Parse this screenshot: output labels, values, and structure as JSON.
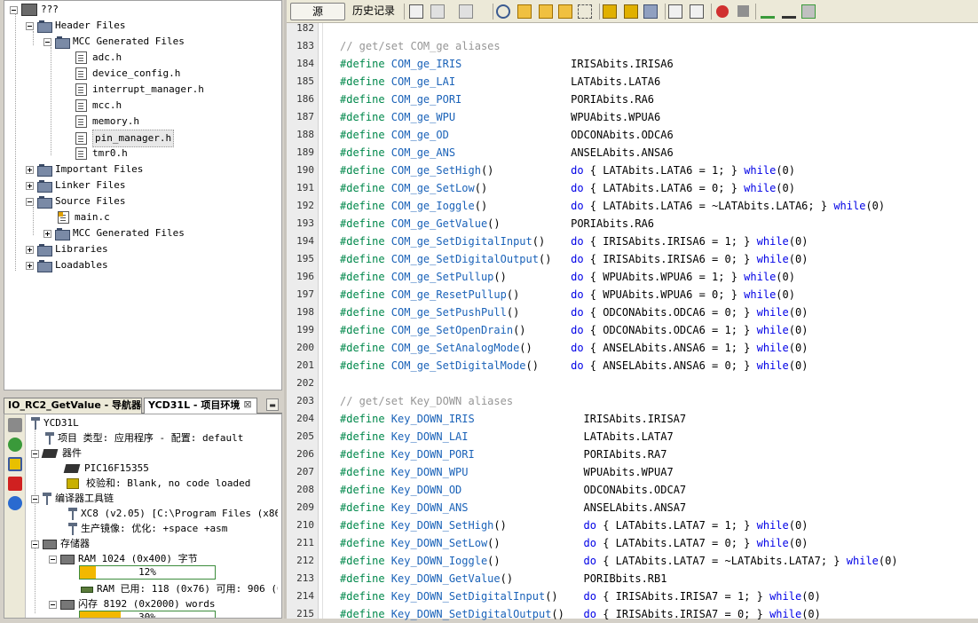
{
  "project_tree": {
    "root": "???",
    "items": [
      {
        "label": "Header Files",
        "type": "folder",
        "level": 1,
        "expanded": true
      },
      {
        "label": "MCC Generated Files",
        "type": "folder",
        "level": 2,
        "expanded": true
      },
      {
        "label": "adc.h",
        "type": "file",
        "level": 3
      },
      {
        "label": "device_config.h",
        "type": "file",
        "level": 3
      },
      {
        "label": "interrupt_manager.h",
        "type": "file",
        "level": 3
      },
      {
        "label": "mcc.h",
        "type": "file",
        "level": 3
      },
      {
        "label": "memory.h",
        "type": "file",
        "level": 3
      },
      {
        "label": "pin_manager.h",
        "type": "file",
        "level": 3,
        "selected": true
      },
      {
        "label": "tmr0.h",
        "type": "file",
        "level": 3
      },
      {
        "label": "Important Files",
        "type": "folder",
        "level": 1,
        "expanded": false
      },
      {
        "label": "Linker Files",
        "type": "folder",
        "level": 1,
        "expanded": false
      },
      {
        "label": "Source Files",
        "type": "folder",
        "level": 1,
        "expanded": true
      },
      {
        "label": "main.c",
        "type": "cfile",
        "level": 2
      },
      {
        "label": "MCC Generated Files",
        "type": "folder",
        "level": 2,
        "expanded": false
      },
      {
        "label": "Libraries",
        "type": "folder",
        "level": 1,
        "expanded": false
      },
      {
        "label": "Loadables",
        "type": "folder",
        "level": 1,
        "expanded": false
      }
    ]
  },
  "bottom_tabs": {
    "navigator": "IO_RC2_GetValue - 导航器",
    "environment": "YCD31L - 项目环境",
    "close_glyph": "⊠",
    "minimize_glyph": "▬"
  },
  "environment": {
    "project_name": "YCD31L",
    "project_type": "项目 类型: 应用程序 - 配置: default",
    "device_group": "器件",
    "device": "PIC16F15355",
    "checksum": "校验和: Blank, no code loaded",
    "toolchain_group": "编译器工具链",
    "compiler": "XC8 (v2.05) [C:\\Program Files (x86)\\M",
    "build_image": "生产镜像: 优化: +space +asm",
    "memory_group": "存储器",
    "ram_label": "RAM 1024 (0x400) 字节",
    "ram_usage_percent": 12,
    "ram_usage_label": "12%",
    "ram_used": "RAM 已用: 118 (0x76) 可用: 906 (0",
    "flash_label": "闪存 8192 (0x2000) words",
    "flash_usage_percent": 30,
    "flash_usage_label": "30%"
  },
  "editor_toolbar": {
    "source_tab": "源",
    "history_tab": "历史记录"
  },
  "code": {
    "lines": [
      {
        "n": "182",
        "parts": []
      },
      {
        "n": "183",
        "parts": [
          {
            "c": "cm",
            "t": "// get/set COM_ge aliases"
          }
        ]
      },
      {
        "n": "184",
        "parts": [
          {
            "c": "pp",
            "t": "#define "
          },
          {
            "c": "mc",
            "t": "COM_ge_IRIS"
          },
          {
            "c": "tx",
            "t": "                 IRISAbits.IRISA6"
          }
        ]
      },
      {
        "n": "185",
        "parts": [
          {
            "c": "pp",
            "t": "#define "
          },
          {
            "c": "mc",
            "t": "COM_ge_LAI"
          },
          {
            "c": "tx",
            "t": "                  LATAbits.LATA6"
          }
        ]
      },
      {
        "n": "186",
        "parts": [
          {
            "c": "pp",
            "t": "#define "
          },
          {
            "c": "mc",
            "t": "COM_ge_PORI"
          },
          {
            "c": "tx",
            "t": "                 PORIAbits.RA6"
          }
        ]
      },
      {
        "n": "187",
        "parts": [
          {
            "c": "pp",
            "t": "#define "
          },
          {
            "c": "mc",
            "t": "COM_ge_WPU"
          },
          {
            "c": "tx",
            "t": "                  WPUAbits.WPUA6"
          }
        ]
      },
      {
        "n": "188",
        "parts": [
          {
            "c": "pp",
            "t": "#define "
          },
          {
            "c": "mc",
            "t": "COM_ge_OD"
          },
          {
            "c": "tx",
            "t": "                   ODCONAbits.ODCA6"
          }
        ]
      },
      {
        "n": "189",
        "parts": [
          {
            "c": "pp",
            "t": "#define "
          },
          {
            "c": "mc",
            "t": "COM_ge_ANS"
          },
          {
            "c": "tx",
            "t": "                  ANSELAbits.ANSA6"
          }
        ]
      },
      {
        "n": "190",
        "parts": [
          {
            "c": "pp",
            "t": "#define "
          },
          {
            "c": "mc",
            "t": "COM_ge_SetHigh"
          },
          {
            "c": "tx",
            "t": "()            "
          },
          {
            "c": "kw",
            "t": "do"
          },
          {
            "c": "tx",
            "t": " { LATAbits.LATA6 = 1; } "
          },
          {
            "c": "kw",
            "t": "while"
          },
          {
            "c": "tx",
            "t": "(0)"
          }
        ]
      },
      {
        "n": "191",
        "parts": [
          {
            "c": "pp",
            "t": "#define "
          },
          {
            "c": "mc",
            "t": "COM_ge_SetLow"
          },
          {
            "c": "tx",
            "t": "()             "
          },
          {
            "c": "kw",
            "t": "do"
          },
          {
            "c": "tx",
            "t": " { LATAbits.LATA6 = 0; } "
          },
          {
            "c": "kw",
            "t": "while"
          },
          {
            "c": "tx",
            "t": "(0)"
          }
        ]
      },
      {
        "n": "192",
        "parts": [
          {
            "c": "pp",
            "t": "#define "
          },
          {
            "c": "mc",
            "t": "COM_ge_Ioggle"
          },
          {
            "c": "tx",
            "t": "()             "
          },
          {
            "c": "kw",
            "t": "do"
          },
          {
            "c": "tx",
            "t": " { LATAbits.LATA6 = ~LATAbits.LATA6; } "
          },
          {
            "c": "kw",
            "t": "while"
          },
          {
            "c": "tx",
            "t": "(0)"
          }
        ]
      },
      {
        "n": "193",
        "parts": [
          {
            "c": "pp",
            "t": "#define "
          },
          {
            "c": "mc",
            "t": "COM_ge_GetValue"
          },
          {
            "c": "tx",
            "t": "()           PORIAbits.RA6"
          }
        ]
      },
      {
        "n": "194",
        "parts": [
          {
            "c": "pp",
            "t": "#define "
          },
          {
            "c": "mc",
            "t": "COM_ge_SetDigitalInput"
          },
          {
            "c": "tx",
            "t": "()    "
          },
          {
            "c": "kw",
            "t": "do"
          },
          {
            "c": "tx",
            "t": " { IRISAbits.IRISA6 = 1; } "
          },
          {
            "c": "kw",
            "t": "while"
          },
          {
            "c": "tx",
            "t": "(0)"
          }
        ]
      },
      {
        "n": "195",
        "parts": [
          {
            "c": "pp",
            "t": "#define "
          },
          {
            "c": "mc",
            "t": "COM_ge_SetDigitalOutput"
          },
          {
            "c": "tx",
            "t": "()   "
          },
          {
            "c": "kw",
            "t": "do"
          },
          {
            "c": "tx",
            "t": " { IRISAbits.IRISA6 = 0; } "
          },
          {
            "c": "kw",
            "t": "while"
          },
          {
            "c": "tx",
            "t": "(0)"
          }
        ]
      },
      {
        "n": "196",
        "parts": [
          {
            "c": "pp",
            "t": "#define "
          },
          {
            "c": "mc",
            "t": "COM_ge_SetPullup"
          },
          {
            "c": "tx",
            "t": "()          "
          },
          {
            "c": "kw",
            "t": "do"
          },
          {
            "c": "tx",
            "t": " { WPUAbits.WPUA6 = 1; } "
          },
          {
            "c": "kw",
            "t": "while"
          },
          {
            "c": "tx",
            "t": "(0)"
          }
        ]
      },
      {
        "n": "197",
        "parts": [
          {
            "c": "pp",
            "t": "#define "
          },
          {
            "c": "mc",
            "t": "COM_ge_ResetPullup"
          },
          {
            "c": "tx",
            "t": "()        "
          },
          {
            "c": "kw",
            "t": "do"
          },
          {
            "c": "tx",
            "t": " { WPUAbits.WPUA6 = 0; } "
          },
          {
            "c": "kw",
            "t": "while"
          },
          {
            "c": "tx",
            "t": "(0)"
          }
        ]
      },
      {
        "n": "198",
        "parts": [
          {
            "c": "pp",
            "t": "#define "
          },
          {
            "c": "mc",
            "t": "COM_ge_SetPushPull"
          },
          {
            "c": "tx",
            "t": "()        "
          },
          {
            "c": "kw",
            "t": "do"
          },
          {
            "c": "tx",
            "t": " { ODCONAbits.ODCA6 = 0; } "
          },
          {
            "c": "kw",
            "t": "while"
          },
          {
            "c": "tx",
            "t": "(0)"
          }
        ]
      },
      {
        "n": "199",
        "parts": [
          {
            "c": "pp",
            "t": "#define "
          },
          {
            "c": "mc",
            "t": "COM_ge_SetOpenDrain"
          },
          {
            "c": "tx",
            "t": "()       "
          },
          {
            "c": "kw",
            "t": "do"
          },
          {
            "c": "tx",
            "t": " { ODCONAbits.ODCA6 = 1; } "
          },
          {
            "c": "kw",
            "t": "while"
          },
          {
            "c": "tx",
            "t": "(0)"
          }
        ]
      },
      {
        "n": "200",
        "parts": [
          {
            "c": "pp",
            "t": "#define "
          },
          {
            "c": "mc",
            "t": "COM_ge_SetAnalogMode"
          },
          {
            "c": "tx",
            "t": "()      "
          },
          {
            "c": "kw",
            "t": "do"
          },
          {
            "c": "tx",
            "t": " { ANSELAbits.ANSA6 = 1; } "
          },
          {
            "c": "kw",
            "t": "while"
          },
          {
            "c": "tx",
            "t": "(0)"
          }
        ]
      },
      {
        "n": "201",
        "parts": [
          {
            "c": "pp",
            "t": "#define "
          },
          {
            "c": "mc",
            "t": "COM_ge_SetDigitalMode"
          },
          {
            "c": "tx",
            "t": "()     "
          },
          {
            "c": "kw",
            "t": "do"
          },
          {
            "c": "tx",
            "t": " { ANSELAbits.ANSA6 = 0; } "
          },
          {
            "c": "kw",
            "t": "while"
          },
          {
            "c": "tx",
            "t": "(0)"
          }
        ]
      },
      {
        "n": "202",
        "parts": []
      },
      {
        "n": "203",
        "parts": [
          {
            "c": "cm",
            "t": "// get/set Key_DOWN aliases"
          }
        ]
      },
      {
        "n": "204",
        "parts": [
          {
            "c": "pp",
            "t": "#define "
          },
          {
            "c": "mc",
            "t": "Key_DOWN_IRIS"
          },
          {
            "c": "tx",
            "t": "                 IRISAbits.IRISA7"
          }
        ]
      },
      {
        "n": "205",
        "parts": [
          {
            "c": "pp",
            "t": "#define "
          },
          {
            "c": "mc",
            "t": "Key_DOWN_LAI"
          },
          {
            "c": "tx",
            "t": "                  LATAbits.LATA7"
          }
        ]
      },
      {
        "n": "206",
        "parts": [
          {
            "c": "pp",
            "t": "#define "
          },
          {
            "c": "mc",
            "t": "Key_DOWN_PORI"
          },
          {
            "c": "tx",
            "t": "                 PORIAbits.RA7"
          }
        ]
      },
      {
        "n": "207",
        "parts": [
          {
            "c": "pp",
            "t": "#define "
          },
          {
            "c": "mc",
            "t": "Key_DOWN_WPU"
          },
          {
            "c": "tx",
            "t": "                  WPUAbits.WPUA7"
          }
        ]
      },
      {
        "n": "208",
        "parts": [
          {
            "c": "pp",
            "t": "#define "
          },
          {
            "c": "mc",
            "t": "Key_DOWN_OD"
          },
          {
            "c": "tx",
            "t": "                   ODCONAbits.ODCA7"
          }
        ]
      },
      {
        "n": "209",
        "parts": [
          {
            "c": "pp",
            "t": "#define "
          },
          {
            "c": "mc",
            "t": "Key_DOWN_ANS"
          },
          {
            "c": "tx",
            "t": "                  ANSELAbits.ANSA7"
          }
        ]
      },
      {
        "n": "210",
        "parts": [
          {
            "c": "pp",
            "t": "#define "
          },
          {
            "c": "mc",
            "t": "Key_DOWN_SetHigh"
          },
          {
            "c": "tx",
            "t": "()            "
          },
          {
            "c": "kw",
            "t": "do"
          },
          {
            "c": "tx",
            "t": " { LATAbits.LATA7 = 1; } "
          },
          {
            "c": "kw",
            "t": "while"
          },
          {
            "c": "tx",
            "t": "(0)"
          }
        ]
      },
      {
        "n": "211",
        "parts": [
          {
            "c": "pp",
            "t": "#define "
          },
          {
            "c": "mc",
            "t": "Key_DOWN_SetLow"
          },
          {
            "c": "tx",
            "t": "()             "
          },
          {
            "c": "kw",
            "t": "do"
          },
          {
            "c": "tx",
            "t": " { LATAbits.LATA7 = 0; } "
          },
          {
            "c": "kw",
            "t": "while"
          },
          {
            "c": "tx",
            "t": "(0)"
          }
        ]
      },
      {
        "n": "212",
        "parts": [
          {
            "c": "pp",
            "t": "#define "
          },
          {
            "c": "mc",
            "t": "Key_DOWN_Ioggle"
          },
          {
            "c": "tx",
            "t": "()             "
          },
          {
            "c": "kw",
            "t": "do"
          },
          {
            "c": "tx",
            "t": " { LATAbits.LATA7 = ~LATAbits.LATA7; } "
          },
          {
            "c": "kw",
            "t": "while"
          },
          {
            "c": "tx",
            "t": "(0)"
          }
        ]
      },
      {
        "n": "213",
        "parts": [
          {
            "c": "pp",
            "t": "#define "
          },
          {
            "c": "mc",
            "t": "Key_DOWN_GetValue"
          },
          {
            "c": "tx",
            "t": "()           PORIBbits.RB1"
          }
        ]
      },
      {
        "n": "214",
        "parts": [
          {
            "c": "pp",
            "t": "#define "
          },
          {
            "c": "mc",
            "t": "Key_DOWN_SetDigitalInput"
          },
          {
            "c": "tx",
            "t": "()    "
          },
          {
            "c": "kw",
            "t": "do"
          },
          {
            "c": "tx",
            "t": " { IRISAbits.IRISA7 = 1; } "
          },
          {
            "c": "kw",
            "t": "while"
          },
          {
            "c": "tx",
            "t": "(0)"
          }
        ]
      },
      {
        "n": "215",
        "parts": [
          {
            "c": "pp",
            "t": "#define "
          },
          {
            "c": "mc",
            "t": "Key_DOWN_SetDigitalOutput"
          },
          {
            "c": "tx",
            "t": "()   "
          },
          {
            "c": "kw",
            "t": "do"
          },
          {
            "c": "tx",
            "t": " { IRISAbits.IRISA7 = 0; } "
          },
          {
            "c": "kw",
            "t": "while"
          },
          {
            "c": "tx",
            "t": "(0)"
          }
        ]
      }
    ]
  }
}
